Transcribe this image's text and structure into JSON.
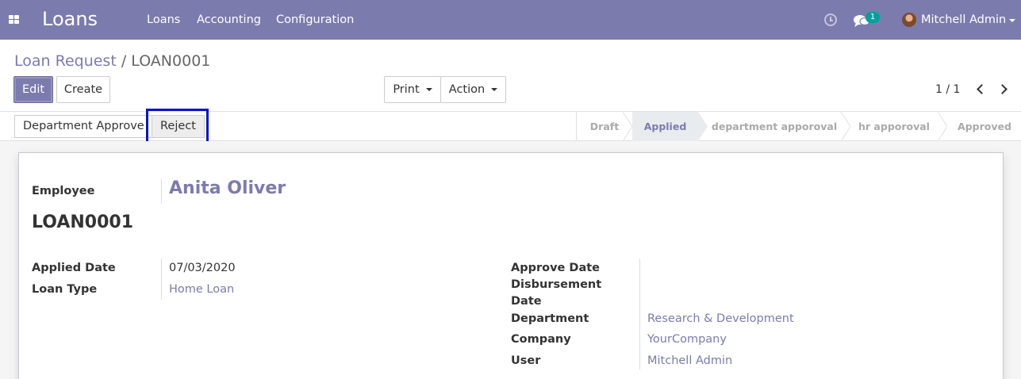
{
  "navbar": {
    "brand": "Loans",
    "menu": [
      "Loans",
      "Accounting",
      "Configuration"
    ],
    "chat_badge": "1",
    "user_name": "Mitchell Admin"
  },
  "breadcrumb": {
    "parent": "Loan Request",
    "separator": "/",
    "current": "LOAN0001"
  },
  "buttons": {
    "edit": "Edit",
    "create": "Create",
    "print": "Print",
    "action": "Action"
  },
  "pager": {
    "value": "1 / 1"
  },
  "statusbar": {
    "dept_approve": "Department Approve",
    "reject": "Reject",
    "stages": [
      "Draft",
      "Applied",
      "department apporoval",
      "hr apporoval",
      "Approved"
    ],
    "active_stage": "Applied"
  },
  "form": {
    "employee_label": "Employee",
    "employee_value": "Anita Oliver",
    "loan_title": "LOAN0001",
    "applied_date_label": "Applied Date",
    "applied_date_value": "07/03/2020",
    "loan_type_label": "Loan Type",
    "loan_type_value": "Home Loan",
    "approve_date_label": "Approve Date",
    "disbursement_label_1": "Disbursement",
    "disbursement_label_2": "Date",
    "department_label": "Department",
    "department_value": "Research & Development",
    "company_label": "Company",
    "company_value": "YourCompany",
    "user_label": "User",
    "user_value": "Mitchell Admin"
  },
  "colors": {
    "brand": "#7c7bad",
    "badge": "#00a09d",
    "highlight": "#0a12cc"
  }
}
